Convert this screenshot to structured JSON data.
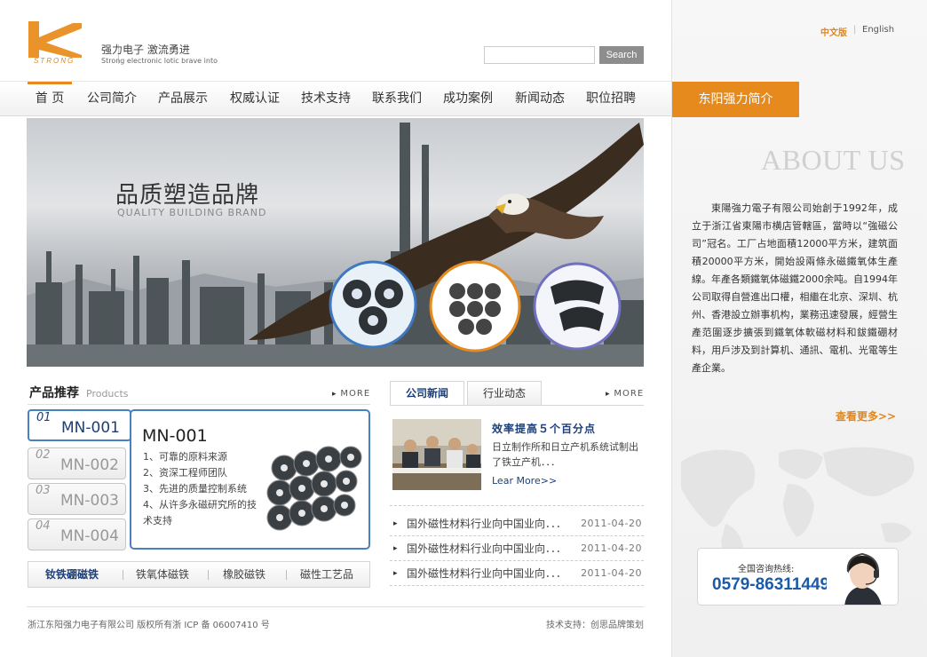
{
  "header": {
    "logo_mark_text": "STRONG",
    "slogan_cn": "强力电子 激流勇进",
    "slogan_en": "Strong electronic lotic brave into",
    "search_placeholder": "",
    "search_button": "Search"
  },
  "nav": {
    "items": [
      {
        "label": "首 页",
        "active": true
      },
      {
        "label": "公司简介",
        "active": false
      },
      {
        "label": "产品展示",
        "active": false
      },
      {
        "label": "权威认证",
        "active": false
      },
      {
        "label": "技术支持",
        "active": false
      },
      {
        "label": "联系我们",
        "active": false
      },
      {
        "label": "成功案例",
        "active": false
      },
      {
        "label": "新闻动态",
        "active": false
      },
      {
        "label": "职位招聘",
        "active": false
      }
    ]
  },
  "banner": {
    "title": "品质塑造品牌",
    "subtitle": "QUALITY BUILDING BRAND"
  },
  "products": {
    "title": "产品推荐",
    "title_en": "Products",
    "more": "MORE",
    "tabs": [
      {
        "num": "01",
        "code": "MN-001",
        "active": true
      },
      {
        "num": "02",
        "code": "MN-002",
        "active": false
      },
      {
        "num": "03",
        "code": "MN-003",
        "active": false
      },
      {
        "num": "04",
        "code": "MN-004",
        "active": false
      }
    ],
    "panel": {
      "name": "MN-001",
      "features": [
        "1、可靠的原料来源",
        "2、资深工程师团队",
        "3、先进的质量控制系统",
        "4、从许多永磁研究所的技术支持"
      ]
    },
    "categories": [
      {
        "label": "钕铁硼磁铁",
        "active": true
      },
      {
        "label": "铁氧体磁铁",
        "active": false
      },
      {
        "label": "橡胶磁铁",
        "active": false
      },
      {
        "label": "磁性工艺品",
        "active": false
      }
    ]
  },
  "news": {
    "tabs": [
      {
        "label": "公司新闻",
        "active": true
      },
      {
        "label": "行业动态",
        "active": false
      }
    ],
    "more": "MORE",
    "headline": "效率提高５个百分点",
    "headline_desc": "日立制作所和日立产机系统试制出了铁立产机．．．",
    "learn_more": "Lear More>>",
    "rows": [
      {
        "title": "国外磁性材料行业向中国业向．．．",
        "date": "2011-04-20"
      },
      {
        "title": "国外磁性材料行业向中国业向．．．",
        "date": "2011-04-20"
      },
      {
        "title": "国外磁性材料行业向中国业向．．．",
        "date": "2011-04-20"
      }
    ]
  },
  "footer": {
    "copyright": "浙江东阳强力电子有限公司 版权所有浙 ICP 备 06007410 号",
    "support": "技术支持：创思品牌策划"
  },
  "sidebar": {
    "lang_cn": "中文版",
    "lang_sep": "|",
    "lang_en": "English",
    "about_tab": "东阳强力简介",
    "about_en": "ABOUT US",
    "about_text": "東陽強力電子有限公司始創于1992年，成立于浙江省東陽市横店管轄區，當時以“強磁公司”冠名。工厂占地面積12000平方米，建筑面積20000平方米，開始設兩條永磁鐵氧体生產線。年產各類鐵氧体磁鐵2000余吨。自1994年公司取得自營進出口權，相繼在北京、深圳、杭州、香港設立辦事机构，業務迅速發展，經營生產范圍逐步擴張到鐵氧体軟磁材料和鈸鐵硼材料，用戶涉及到計算机、通訊、電机、光電等生產企業。",
    "see_more": "查看更多>>",
    "hotline_label": "全国咨询热线:",
    "hotline_number": "0579-86311449"
  },
  "colors": {
    "accent": "#e68a1e",
    "link_blue": "#1b3f7a",
    "border_blue": "#4a7fc1"
  }
}
